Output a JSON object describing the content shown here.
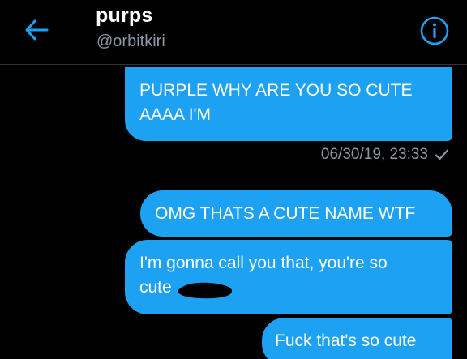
{
  "header": {
    "title": "purps",
    "handle": "@orbitkiri",
    "back_icon": "arrow-left-icon",
    "info_icon": "info-circle-icon"
  },
  "messages": [
    {
      "lines": [
        "PURPLE WHY ARE YOU SO CUTE",
        "AAAA I'M"
      ],
      "timestamp": "06/30/19, 23:33",
      "status_icon": "checkmark-icon"
    },
    {
      "lines": [
        "OMG THATS A CUTE NAME WTF"
      ]
    },
    {
      "lines": [
        "I'm gonna call you that, you're so",
        "cute"
      ]
    },
    {
      "lines": [
        "Fuck that's so cute"
      ]
    }
  ],
  "colors": {
    "accent": "#1da1f2",
    "background": "#000000",
    "muted_text": "#8b98a5"
  }
}
